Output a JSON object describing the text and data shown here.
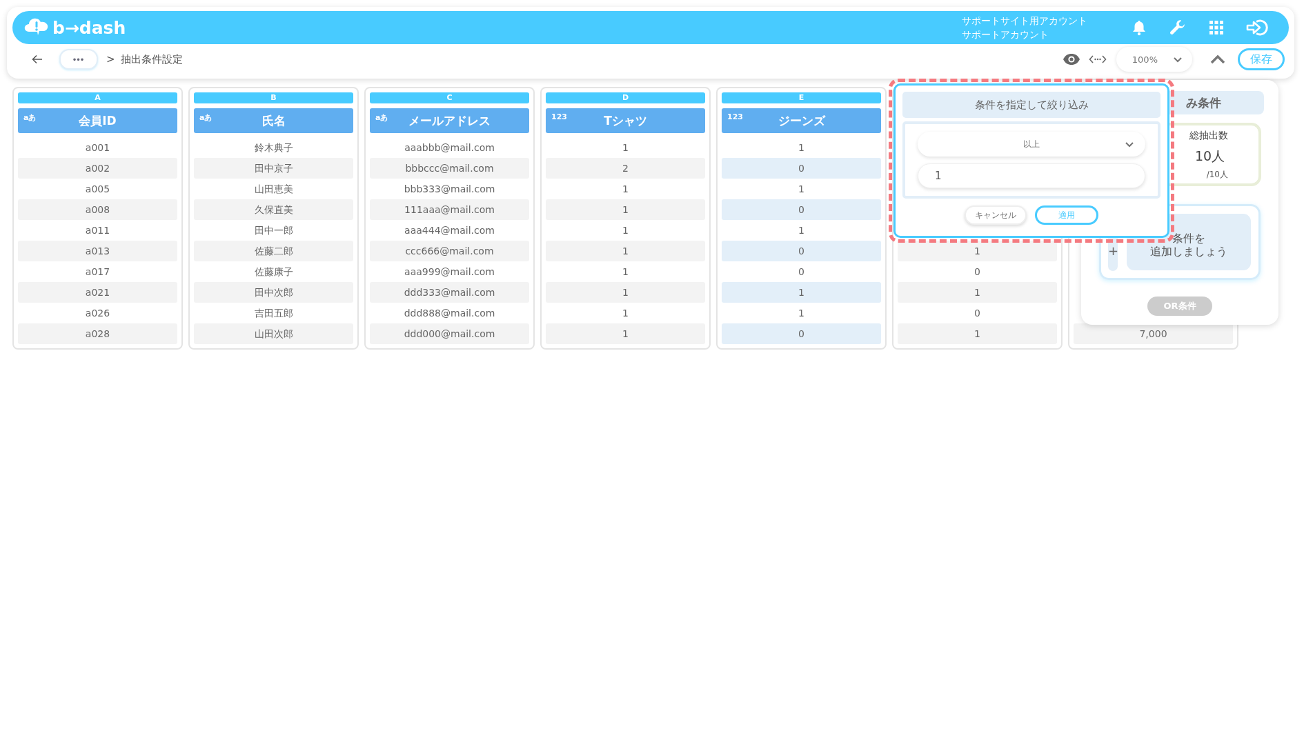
{
  "header": {
    "logo": "b→dash",
    "account_lines": [
      "サポートサイト用アカウント",
      "サポートアカウント"
    ]
  },
  "toolbar": {
    "more_button": "•••",
    "separator": ">",
    "breadcrumb": "抽出条件設定",
    "zoom": "100%",
    "save_button": "保存"
  },
  "columns": [
    {
      "letter": "A",
      "type_badge": "aあ",
      "name": "会員ID",
      "selected": false,
      "cells": [
        "a001",
        "a002",
        "a005",
        "a008",
        "a011",
        "a013",
        "a017",
        "a021",
        "a026",
        "a028"
      ]
    },
    {
      "letter": "B",
      "type_badge": "aあ",
      "name": "氏名",
      "selected": false,
      "cells": [
        "鈴木典子",
        "田中京子",
        "山田恵美",
        "久保直美",
        "田中一郎",
        "佐藤二郎",
        "佐藤康子",
        "田中次郎",
        "吉田五郎",
        "山田次郎"
      ]
    },
    {
      "letter": "C",
      "type_badge": "aあ",
      "name": "メールアドレス",
      "selected": false,
      "cells": [
        "aaabbb@mail.com",
        "bbbccc@mail.com",
        "bbb333@mail.com",
        "111aaa@mail.com",
        "aaa444@mail.com",
        "ccc666@mail.com",
        "aaa999@mail.com",
        "ddd333@mail.com",
        "ddd888@mail.com",
        "ddd000@mail.com"
      ]
    },
    {
      "letter": "D",
      "type_badge": "123",
      "name": "Tシャツ",
      "selected": false,
      "cells": [
        "1",
        "2",
        "1",
        "1",
        "1",
        "1",
        "1",
        "1",
        "1",
        "1"
      ]
    },
    {
      "letter": "E",
      "type_badge": "123",
      "name": "ジーンズ",
      "selected": true,
      "cells": [
        "1",
        "0",
        "1",
        "0",
        "1",
        "0",
        "0",
        "1",
        "1",
        "0"
      ]
    },
    {
      "selected": false,
      "cells": [
        "1",
        "0",
        "1",
        "0",
        "1"
      ]
    },
    {
      "selected": false,
      "cells": [
        "7,000"
      ]
    }
  ],
  "popup": {
    "title": "条件を指定して絞り込み",
    "operator": "以上",
    "value": "1",
    "cancel_button": "キャンセル",
    "apply_button": "適用"
  },
  "conditions_panel": {
    "title": "み条件",
    "total_label": "総抽出数",
    "total_count": "10人",
    "total_of": "/10人",
    "add_icon": "+",
    "add_prompt_lines": [
      "条件を",
      "追加しましょう"
    ],
    "or_button": {
      "label": "OR条件",
      "disabled": true
    }
  }
}
